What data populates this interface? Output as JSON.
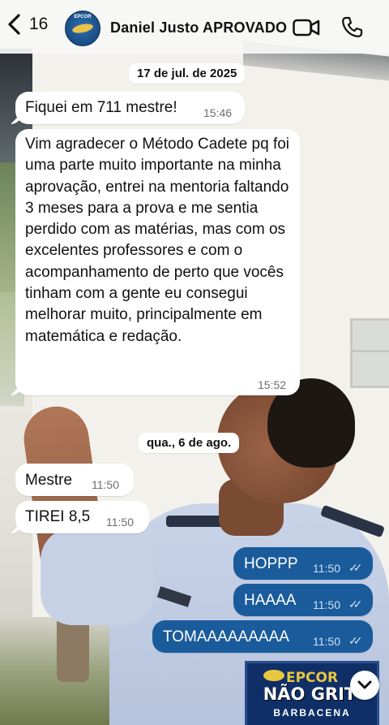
{
  "header": {
    "back_count": "16",
    "avatar_text": "EPCOR",
    "contact_name": "Daniel Justo APROVADO"
  },
  "messages": {
    "date1": "17 de jul. de 2025",
    "m1": {
      "text": "Fiquei em 711 mestre!",
      "time": "15:46"
    },
    "m2": {
      "text": "Vim agradecer o Método Cadete pq foi uma parte muito importante na minha aprovação, entrei na mentoria faltando 3 meses para a prova e me sentia perdido com as matérias, mas com os excelentes professores e com o acompanhamento de perto que vocês tinham com a gente eu consegui melhorar muito, principalmente em matemática e redação.",
      "time": "15:52"
    },
    "date2": "qua., 6 de ago.",
    "m3": {
      "text": "Mestre",
      "time": "11:50"
    },
    "m4": {
      "text": "TIREI 8,5",
      "time": "11:50"
    },
    "m5": {
      "text": "HOPPP",
      "time": "11:50"
    },
    "m6": {
      "text": "HAAAA",
      "time": "11:50"
    },
    "m7": {
      "text": "TOMAAAAAAAAA",
      "time": "11:50"
    },
    "read_ticks": "✓✓"
  },
  "sticker": {
    "top": "EPCOR",
    "middle": "NÃO GRIT",
    "bottom": "BARBACENA"
  },
  "icons": {
    "back": "chevron-left-icon",
    "video": "video-camera-icon",
    "phone": "phone-icon",
    "scroll": "chevron-down-icon"
  },
  "colors": {
    "outgoing_bubble": "#1a5b9c",
    "incoming_bubble": "#ffffff"
  }
}
